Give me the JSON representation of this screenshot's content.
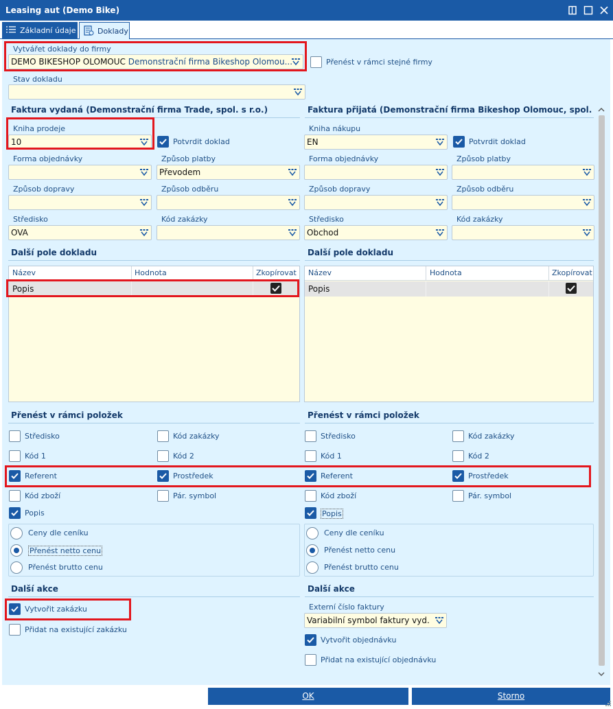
{
  "window": {
    "title": "Leasing aut (Demo Bike)"
  },
  "tabs": [
    {
      "label": "Základní údaje",
      "icon": "list-icon",
      "active": false
    },
    {
      "label": "Doklady",
      "icon": "document-icon",
      "active": true
    }
  ],
  "top": {
    "firm_label": "Vytvářet doklady do firmy",
    "firm_code": "DEMO BIKESHOP OLOMOUC",
    "firm_name": "Demonstrační firma Bikeshop Olomou...",
    "same_firm_label": "Přenést v rámci stejné firmy",
    "state_label": "Stav dokladu",
    "state_value": ""
  },
  "left": {
    "section_title": "Faktura vydaná (Demonstrační firma Trade, spol. s r.o.)",
    "book_label": "Kniha prodeje",
    "book_value": "10",
    "confirm_label": "Potvrdit doklad",
    "order_form_label": "Forma objednávky",
    "order_form_value": "",
    "payment_label": "Způsob platby",
    "payment_value": "Převodem",
    "transport_label": "Způsob dopravy",
    "transport_value": "",
    "pickup_label": "Způsob odběru",
    "pickup_value": "",
    "center_label": "Středisko",
    "center_value": "OVA",
    "job_label": "Kód zakázky",
    "job_value": "",
    "fields_title": "Další pole dokladu",
    "grid_headers": [
      "Název",
      "Hodnota",
      "Zkopírovat"
    ],
    "grid_row": {
      "name": "Popis",
      "value": ""
    },
    "items_title": "Přenést v rámci položek",
    "items": [
      "Středisko",
      "Kód zakázky",
      "Kód 1",
      "Kód 2",
      "Referent",
      "Prostředek",
      "Kód zboží",
      "Pár. symbol",
      "Popis"
    ],
    "prices": [
      "Ceny dle ceníku",
      "Přenést netto cenu",
      "Přenést brutto cenu"
    ],
    "actions_title": "Další akce",
    "action_create": "Vytvořit zakázku",
    "action_add": "Přidat na existující zakázku"
  },
  "right": {
    "section_title": "Faktura přijatá (Demonstrační firma Bikeshop Olomouc, spol. s r....",
    "book_label": "Kniha nákupu",
    "book_value": "EN",
    "confirm_label": "Potvrdit doklad",
    "order_form_label": "Forma objednávky",
    "order_form_value": "",
    "payment_label": "Způsob platby",
    "payment_value": "",
    "transport_label": "Způsob dopravy",
    "transport_value": "",
    "pickup_label": "Způsob odběru",
    "pickup_value": "",
    "center_label": "Středisko",
    "center_value": "Obchod",
    "job_label": "Kód zakázky",
    "job_value": "",
    "fields_title": "Další pole dokladu",
    "grid_headers": [
      "Název",
      "Hodnota",
      "Zkopírovat"
    ],
    "grid_row": {
      "name": "Popis",
      "value": ""
    },
    "items_title": "Přenést v rámci položek",
    "items": [
      "Středisko",
      "Kód zakázky",
      "Kód 1",
      "Kód 2",
      "Referent",
      "Prostředek",
      "Kód zboží",
      "Pár. symbol",
      "Popis"
    ],
    "prices": [
      "Ceny dle ceníku",
      "Přenést netto cenu",
      "Přenést brutto cenu"
    ],
    "actions_title": "Další akce",
    "ext_invoice_label": "Externí číslo faktury",
    "ext_invoice_value": "Variabilní symbol faktury vyd.",
    "action_create": "Vytvořit objednávku",
    "action_add": "Přidat na existující objednávku"
  },
  "footer": {
    "ok": "OK",
    "cancel": "Storno"
  },
  "colors": {
    "accent": "#1a5aa6",
    "panel": "#dff3ff",
    "input": "#fffde2",
    "highlight": "#e3161d"
  }
}
